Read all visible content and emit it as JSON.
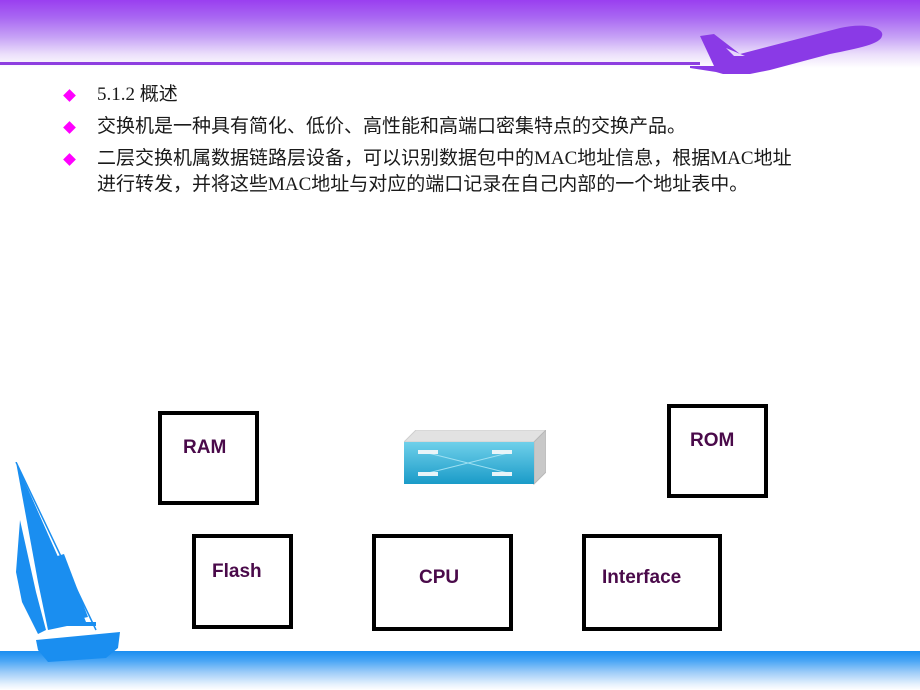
{
  "slide": {
    "bullets": [
      {
        "text": "5.1.2 概述"
      },
      {
        "text": "交换机是一种具有简化、低价、高性能和高端口密集特点的交换产品。"
      },
      {
        "text": "二层交换机属数据链路层设备，可以识别数据包中的MAC地址信息，根据MAC地址进行转发，并将这些MAC地址与对应的端口记录在自己内部的一个地址表中。"
      }
    ],
    "bullet_color": "#ff00ff",
    "header_color": "#9a3ff0",
    "footer_color": "#1a8ef0"
  },
  "diagram": {
    "switch_icon": "network-switch-icon",
    "components": [
      {
        "label": "RAM"
      },
      {
        "label": "ROM"
      },
      {
        "label": "Flash"
      },
      {
        "label": "CPU"
      },
      {
        "label": "Interface"
      }
    ],
    "label_color": "#4a0a4a"
  }
}
